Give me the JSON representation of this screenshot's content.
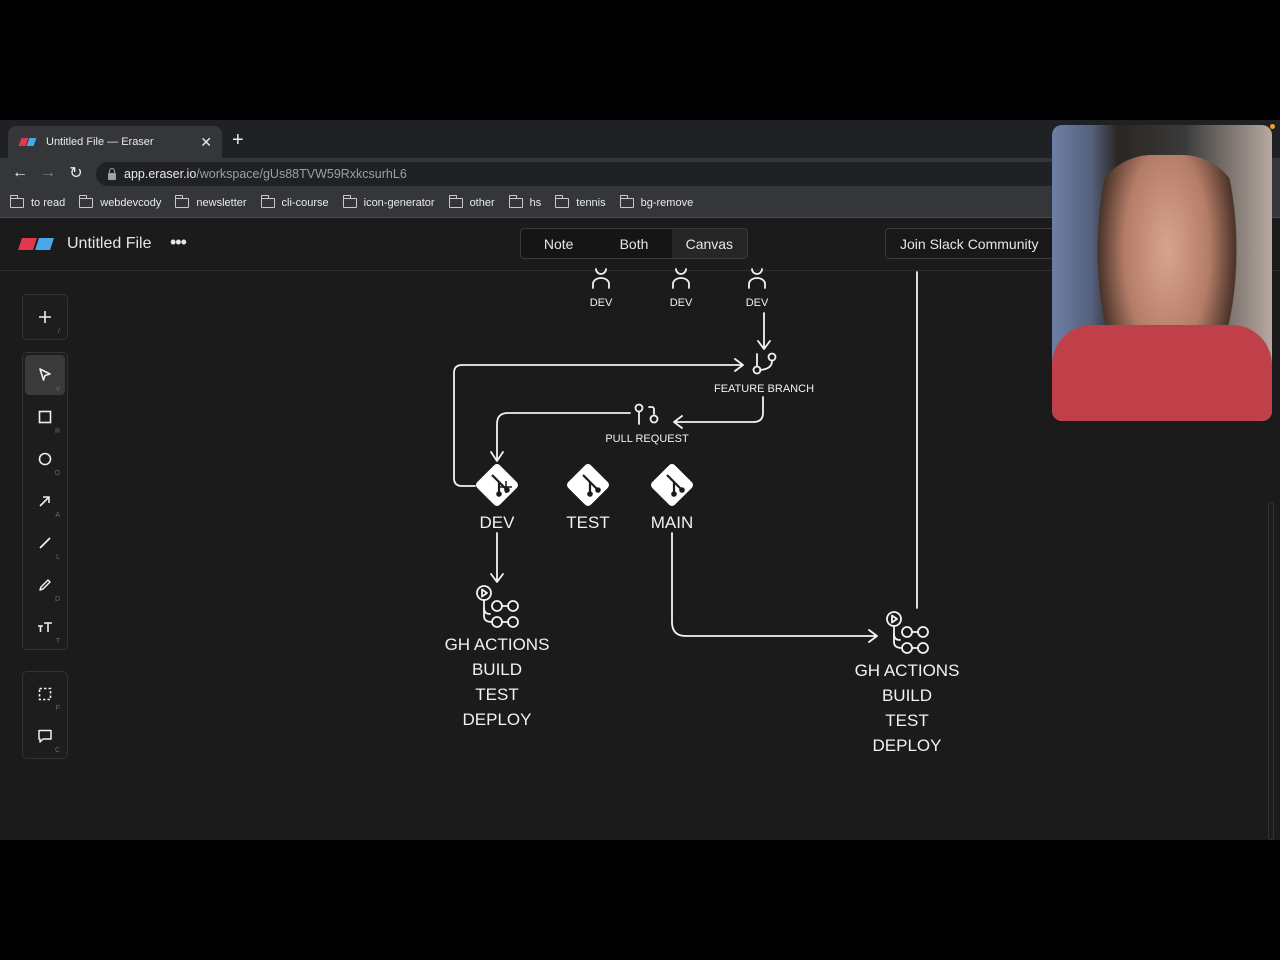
{
  "browser": {
    "tab_title": "Untitled File — Eraser",
    "url_host": "app.eraser.io",
    "url_path": "/workspace/gUs88TVW59RxkcsurhL6",
    "bookmarks": [
      "to read",
      "webdevcody",
      "newsletter",
      "cli-course",
      "icon-generator",
      "other",
      "hs",
      "tennis",
      "bg-remove"
    ]
  },
  "app": {
    "logo_colors": {
      "red": "#e0384f",
      "blue": "#4aa8e8"
    },
    "file_title": "Untitled File",
    "more_label": "•••",
    "view_modes": [
      {
        "label": "Note",
        "active": false
      },
      {
        "label": "Both",
        "active": false
      },
      {
        "label": "Canvas",
        "active": true
      }
    ],
    "slack_button": "Join Slack Community"
  },
  "toolbar": {
    "groups": [
      [
        {
          "name": "add",
          "key": "/"
        }
      ],
      [
        {
          "name": "select",
          "key": "V",
          "active": true
        },
        {
          "name": "rectangle",
          "key": "R"
        },
        {
          "name": "ellipse",
          "key": "O"
        },
        {
          "name": "arrow",
          "key": "A"
        },
        {
          "name": "line",
          "key": "L"
        },
        {
          "name": "pencil",
          "key": "D"
        },
        {
          "name": "text",
          "key": "T"
        }
      ],
      [
        {
          "name": "frame",
          "key": "F"
        },
        {
          "name": "comment",
          "key": "C"
        }
      ]
    ]
  },
  "diagram": {
    "devs": [
      "DEV",
      "DEV",
      "DEV"
    ],
    "feature_branch": "FEATURE BRANCH",
    "pull_request": "PULL REQUEST",
    "branches": [
      "DEV",
      "TEST",
      "MAIN"
    ],
    "actions_left": [
      "GH ACTIONS",
      "BUILD",
      "TEST",
      "DEPLOY"
    ],
    "actions_right": [
      "GH ACTIONS",
      "BUILD",
      "TEST",
      "DEPLOY"
    ]
  }
}
